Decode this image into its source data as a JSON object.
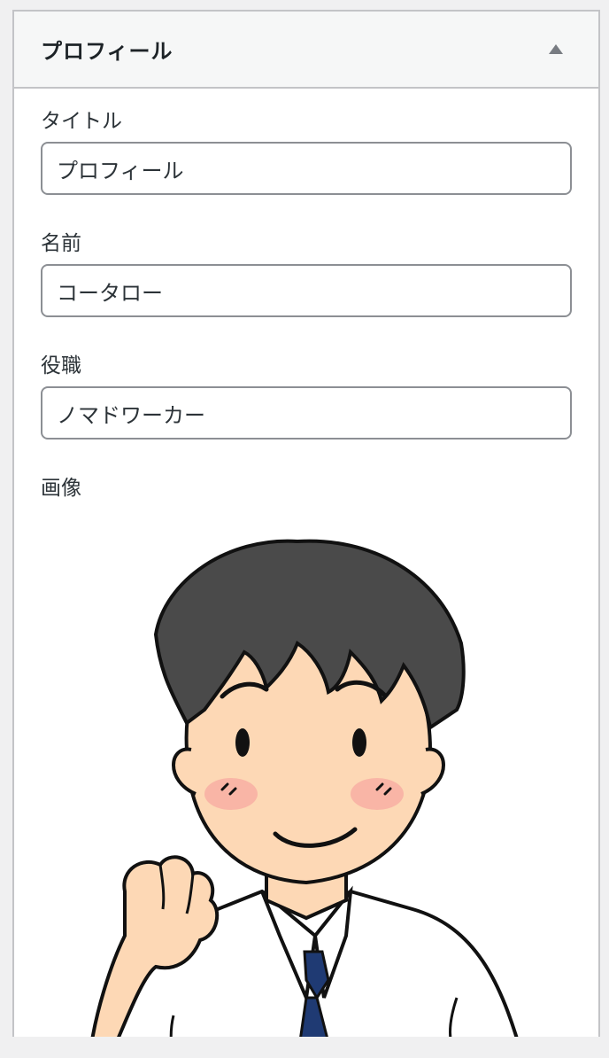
{
  "widget": {
    "title": "プロフィール",
    "toggle_icon": "triangle-up-icon"
  },
  "fields": {
    "title": {
      "label": "タイトル",
      "value": "プロフィール"
    },
    "name": {
      "label": "名前",
      "value": "コータロー"
    },
    "position": {
      "label": "役職",
      "value": "ノマドワーカー"
    },
    "image": {
      "label": "画像"
    }
  },
  "colors": {
    "hair": "#4a4a4a",
    "skin": "#fdd8b5",
    "blush": "#f6a6a0",
    "tie": "#1f3a73",
    "outline": "#111111"
  }
}
